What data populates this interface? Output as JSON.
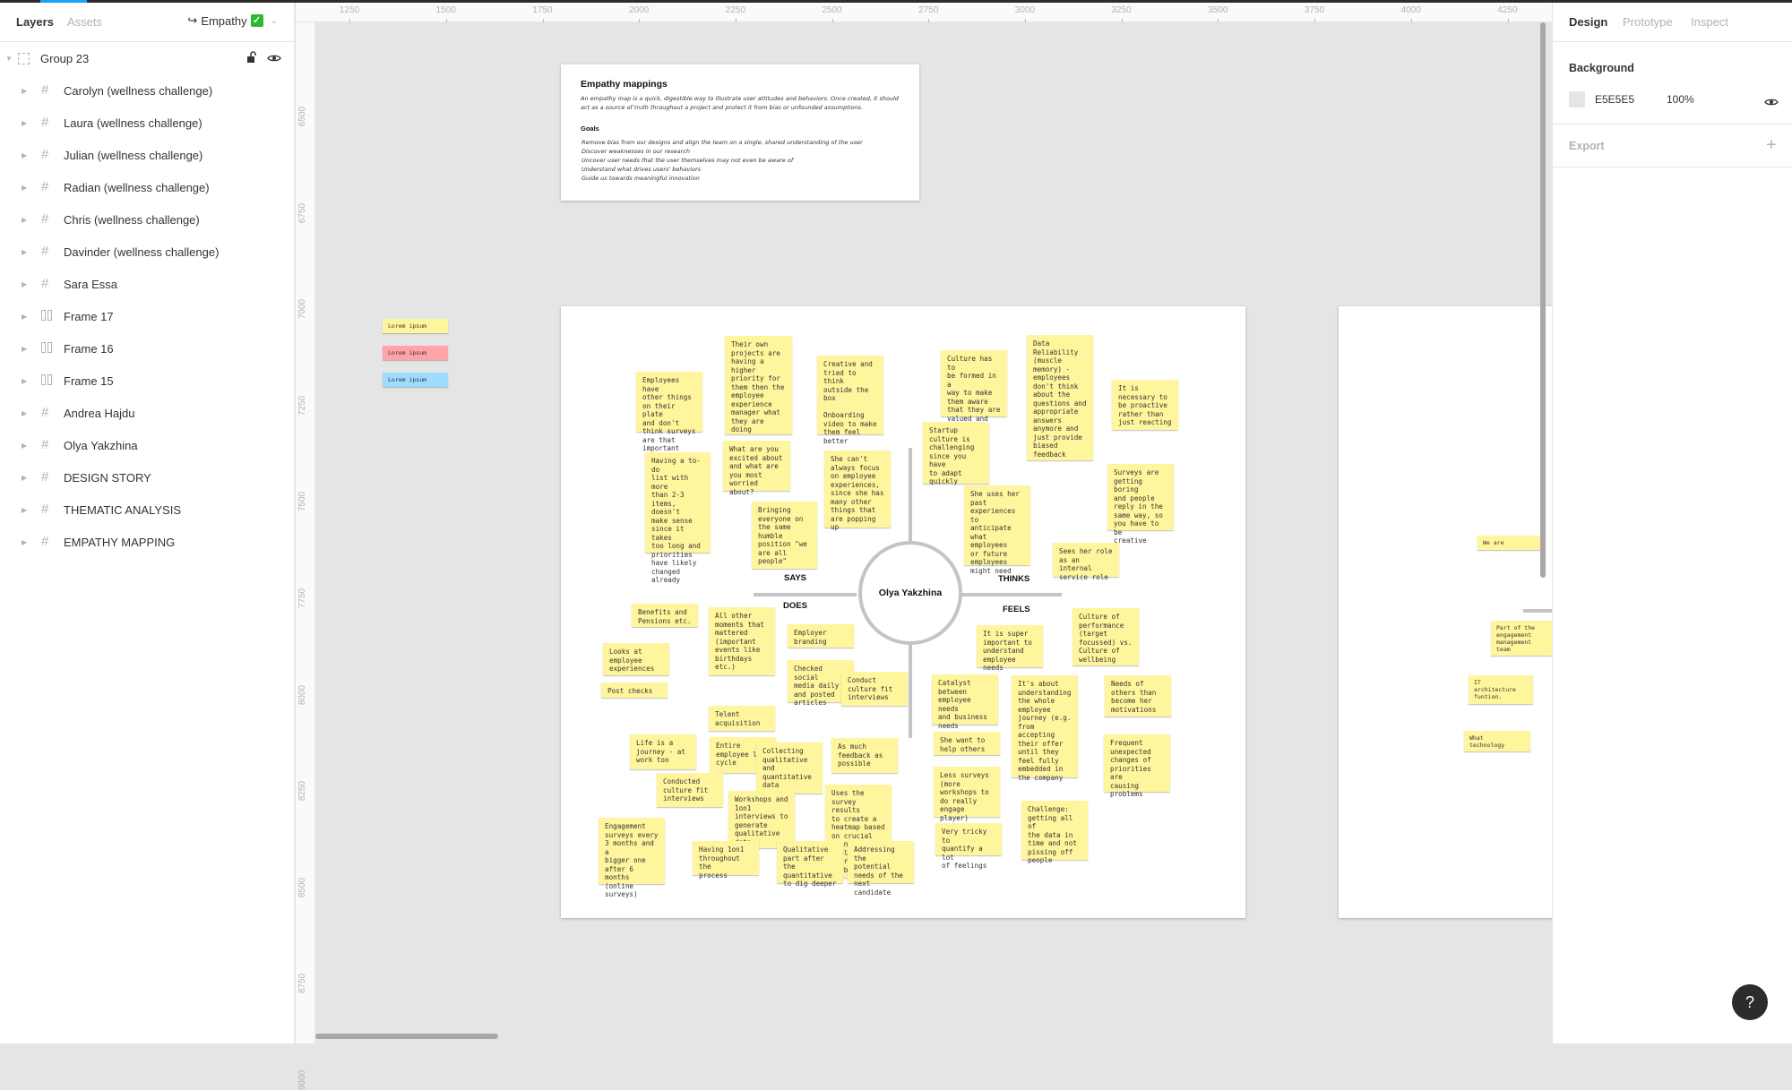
{
  "left_panel": {
    "tabs": [
      "Layers",
      "Assets"
    ],
    "page_name": "Empathy",
    "group": "Group 23",
    "layers": [
      {
        "name": "Carolyn (wellness challenge)",
        "icon": "frame-grid-icon"
      },
      {
        "name": "Laura (wellness challenge)",
        "icon": "frame-grid-icon"
      },
      {
        "name": "Julian (wellness challenge)",
        "icon": "frame-grid-icon"
      },
      {
        "name": "Radian (wellness challenge)",
        "icon": "frame-grid-icon"
      },
      {
        "name": "Chris (wellness challenge)",
        "icon": "frame-grid-icon"
      },
      {
        "name": "Davinder (wellness challenge)",
        "icon": "frame-grid-icon"
      },
      {
        "name": "Sara Essa",
        "icon": "frame-grid-icon"
      },
      {
        "name": "Frame 17",
        "icon": "auto-layout-icon"
      },
      {
        "name": "Frame 16",
        "icon": "auto-layout-icon"
      },
      {
        "name": "Frame 15",
        "icon": "auto-layout-icon"
      },
      {
        "name": "Andrea Hajdu",
        "icon": "frame-grid-icon"
      },
      {
        "name": "Olya Yakzhina",
        "icon": "frame-grid-icon"
      },
      {
        "name": "DESIGN STORY",
        "icon": "frame-grid-icon"
      },
      {
        "name": "THEMATIC ANALYSIS",
        "icon": "frame-grid-icon"
      },
      {
        "name": "EMPATHY MAPPING",
        "icon": "frame-grid-icon"
      }
    ]
  },
  "rulers": {
    "top": [
      "1250",
      "1500",
      "1750",
      "2000",
      "2250",
      "2500",
      "2750",
      "3000",
      "3250",
      "3500",
      "3750",
      "4000",
      "4250"
    ],
    "left": [
      "6500",
      "6750",
      "7000",
      "7250",
      "7500",
      "7750",
      "8000",
      "8250",
      "8500",
      "8750",
      "9000"
    ]
  },
  "intro_card": {
    "title": "Empathy mappings",
    "description": "An empathy map is a quick, digestible way to illustrate user attitudes and behaviors. Once created, it should act as a source of truth throughout a project and protect it from bias or unfounded assumptions.",
    "goals_title": "Goals",
    "goals": [
      "Remove bias from our designs and align the team on a single, shared understanding of the user",
      "Discover weaknesses in our research",
      "Uncover user needs that the user themselves may not even be aware of",
      "Understand what drives users' behaviors",
      "Guide us towards meaningful innovation"
    ]
  },
  "legend_stickies": [
    {
      "text": "Lorem ipsum",
      "color": "#fff59c"
    },
    {
      "text": "Lorem ipsum",
      "color": "#ffa3a6"
    },
    {
      "text": "Lorem ipsum",
      "color": "#9ddcff"
    }
  ],
  "empathy_map": {
    "persona": "Olya Yakzhina",
    "quadrants": {
      "says": "SAYS",
      "thinks": "THINKS",
      "does": "DOES",
      "feels": "FEELS"
    },
    "stickies": [
      "Employees have\nother things\non their plate\nand don't\nthink surveys\nare that\nimportant",
      "Their own\nprojects are\nhaving a\nhigher\npriority for\nthem then the\nemployee\nexperience\nmanager what\nthey are doing",
      "Creative and\ntried to think\noutside the\nbox\n\nOnboarding\nvideo to make\nthem feel\nbetter",
      "What are you\nexcited about\nand what are\nyou most\nworried about?",
      "Having a to-do\nlist with more\nthan 2-3\nitems, doesn't\nmake sense\nsince it takes\ntoo long and\npriorities\nhave likely\nchanged\nalready",
      "She can't\nalways focus\non employee\nexperiences,\nsince she has\nmany other\nthings that\nare popping up",
      "Bringing\neveryone on\nthe same\nhumble\nposition \"we\nare all\npeople\"",
      "Culture has to\nbe formed in a\nway to make\nthem aware\nthat they are\nvalued and\nhave an impact",
      "Data\nReliability\n(muscle\nmemory) -\nemployees\ndon't think\nabout the\nquestions and\nappropriate\nanswers\nanymore and\njust provide\nbiased\nfeedback",
      "It is\nnecessary to\nbe proactive\nrather than\njust reacting",
      "Startup\nculture is\nchallenging\nsince you have\nto adapt\nquickly",
      "Surveys are\ngetting boring\nand people\nreply in the\nsame way, so\nyou have to be\ncreative",
      "She uses her\npast\nexperiences to\nanticipate\nwhat employees\nor future\nemployees\nmight need",
      "Sees her role\nas an internal\nservice role",
      "Benefits and\nPensions etc.",
      "All other\nmoments that\nmattered\n(important\nevents like\nbirthdays\netc.)",
      "Employer\nbranding",
      "Looks at\nemployee\nexperiences",
      "Checked social\nmedia daily\nand posted\narticles",
      "Conduct\nculture fit\ninterviews",
      "Post checks",
      "Telent\nacquisition",
      "Life is a\njourney - at\nwork too",
      "Entire\nemployee life\ncycle",
      "Collecting\nqualitative\nand\nquantitative\ndata",
      "As much\nfeedback as\npossible",
      "Conducted\nculture fit\ninterviews",
      "Workshops and\n1on1\ninterviews to\ngenerate\nqualitative\ndata",
      "Uses the\nsurvey results\nto create a\nheatmap based\non crucial\npoints in the\nemployees\njourneys\n(onboarding,",
      "Engagement\nsurveys every\n3 months and a\nbigger one\nafter 6 months\n(online\nsurveys)",
      "Having 1on1\nthroughout the\nprocess",
      "Qualitative\npart after the\nquantitative\nto dig deeper",
      "Addressing the\npotential\nneeds of the\nnext candidate",
      "It is super\nimportant to\nunderstand\nemployee needs",
      "Culture of\nperformance\n(target\nfocussed) vs.\nCulture of\nwellbeing",
      "Catalyst\nbetween\nemployee needs\nand business\nneeds",
      "It's about\nunderstanding\nthe whole\nemployee\njourney (e.g.\nfrom accepting\ntheir offer\nuntil they\nfeel fully\nembedded in\nthe company",
      "Needs of\nothers than\nbecome her\nmotivations",
      "She want to\nhelp others",
      "Frequent\nunexpected\nchanges of\npriorities are\ncausing\nproblems",
      "Less surveys\n(more\nworkshops to\ndo really\nengage player)",
      "Challenge:\ngetting all of\nthe data in\ntime and not\npissing off\npeople",
      "Very tricky to\nquantify a lot\nof feelings"
    ]
  },
  "partial_frame_stickies": [
    "We are",
    "Part of the\nengagement\nmanagement\nteam",
    "IT\narchitecture\nfuntion.",
    "What\ntechnology"
  ],
  "right_panel": {
    "tabs": [
      "Design",
      "Prototype",
      "Inspect"
    ],
    "background_label": "Background",
    "background_hex": "E5E5E5",
    "background_opacity": "100%",
    "export_label": "Export"
  },
  "help": "?"
}
